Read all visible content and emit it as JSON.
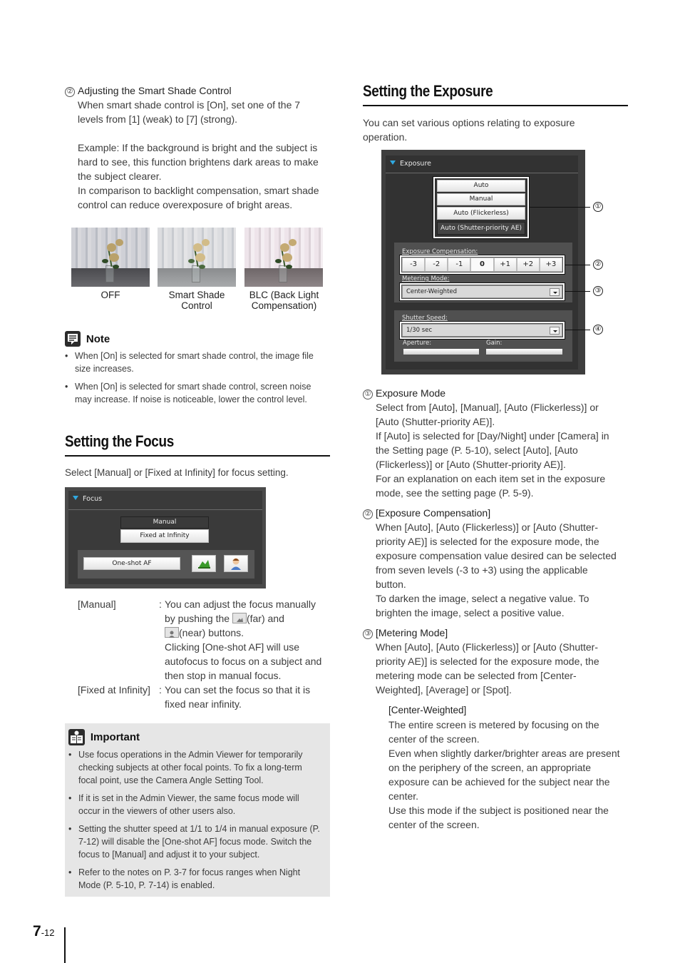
{
  "left_column": {
    "smart_shade": {
      "number": "②",
      "title": "Adjusting the Smart Shade Control",
      "lines": [
        "When smart shade control is [On], set one of the 7",
        "levels from [1] (weak) to [7] (strong).",
        "",
        "Example: If the background is bright and the subject is",
        "hard to see, this function brightens dark areas to make",
        "the subject clearer.",
        "In comparison to backlight compensation, smart shade",
        "control can reduce overexposure of bright areas."
      ]
    },
    "photos": [
      {
        "caption_line1": "OFF",
        "caption_line2": ""
      },
      {
        "caption_line1": "Smart Shade",
        "caption_line2": "Control"
      },
      {
        "caption_line1": "BLC (Back Light",
        "caption_line2": "Compensation)"
      }
    ],
    "note": {
      "title": "Note",
      "icon": "note-icon",
      "items": [
        "When [On] is selected for smart shade control, the image file size increases.",
        "When [On] is selected for smart shade control, screen noise may increase.  If noise is noticeable, lower the control level."
      ]
    },
    "focus": {
      "heading": "Setting the Focus",
      "intro": "Select [Manual] or [Fixed at Infinity] for focus setting.",
      "ui": {
        "panel_title": "Focus",
        "mode_options": [
          "Manual",
          "Fixed at Infinity"
        ],
        "selected_mode": "Manual",
        "one_shot_af_label": "One-shot AF",
        "far_button_icon": "landscape-far-icon",
        "near_button_icon": "person-near-icon"
      },
      "definitions": [
        {
          "term": "[Manual]",
          "lines": [
            "You can adjust the focus manually",
            "by pushing the",
            "(far) and",
            "(near) buttons.",
            "Clicking [One-shot AF] will use",
            "autofocus to focus on a subject and",
            "then stop in manual focus."
          ]
        },
        {
          "term": "[Fixed at Infinity]",
          "lines": [
            "You can set the focus so that it is",
            "fixed near infinity."
          ]
        }
      ]
    },
    "important": {
      "title": "Important",
      "icon": "important-icon",
      "items": [
        "Use focus operations in the Admin Viewer for temporarily checking subjects at other focal points. To fix a long-term focal point, use the Camera Angle Setting Tool.",
        "If it is set in the Admin Viewer, the same focus mode will occur in the viewers of other users also.",
        "Setting the shutter speed at 1/1 to 1/4 in manual exposure (P. 7-12) will disable the [One-shot AF] focus mode. Switch the focus to [Manual] and adjust it to your subject.",
        "Refer to the notes on P. 3-7 for focus ranges when Night Mode (P. 5-10, P. 7-14) is enabled."
      ]
    }
  },
  "right_column": {
    "heading": "Setting the Exposure",
    "intro_lines": [
      "You can set various options relating to exposure",
      "operation."
    ],
    "ui": {
      "panel_title": "Exposure",
      "modes": [
        "Auto",
        "Manual",
        "Auto (Flickerless)",
        "Auto (Shutter-priority AE)"
      ],
      "selected_mode": "Auto (Shutter-priority AE)",
      "exposure_compensation_label": "Exposure Compensation:",
      "compensation_values": [
        "-3",
        "-2",
        "-1",
        "0",
        "+1",
        "+2",
        "+3"
      ],
      "selected_compensation": "0",
      "metering_mode_label": "Metering Mode:",
      "metering_mode_value": "Center-Weighted",
      "shutter_speed_label": "Shutter Speed:",
      "shutter_speed_value": "1/30 sec",
      "aperture_label": "Aperture:",
      "gain_label": "Gain:",
      "callouts": [
        "①",
        "②",
        "③",
        "④"
      ]
    },
    "items": [
      {
        "number": "①",
        "title": "Exposure Mode",
        "lines": [
          "Select from [Auto], [Manual], [Auto (Flickerless)] or",
          "[Auto (Shutter-priority AE)].",
          "If [Auto] is selected for [Day/Night] under [Camera] in",
          "the Setting page (P. 5-10), select [Auto], [Auto",
          "(Flickerless)] or [Auto (Shutter-priority AE)].",
          "For an explanation on each item set in the exposure",
          "mode, see the setting page (P. 5-9)."
        ]
      },
      {
        "number": "②",
        "title": "[Exposure Compensation]",
        "lines": [
          "When [Auto], [Auto (Flickerless)] or [Auto (Shutter-",
          "priority AE)] is selected for the exposure mode, the",
          "exposure compensation value desired can be selected",
          "from seven levels (-3 to +3) using the applicable",
          "button.",
          "To darken the image, select a negative value. To",
          "brighten the image, select a positive value."
        ]
      },
      {
        "number": "③",
        "title": "[Metering Mode]",
        "lines": [
          "When [Auto], [Auto (Flickerless)] or [Auto (Shutter-",
          "priority AE)] is selected for the exposure mode, the",
          "metering mode can be selected from [Center-",
          "Weighted], [Average] or [Spot]."
        ]
      }
    ],
    "center_weighted": {
      "title": "[Center-Weighted]",
      "lines": [
        "The entire screen is metered by focusing on the",
        "center of the screen.",
        "Even when slightly darker/brighter areas are present",
        "on the periphery of the screen, an appropriate",
        "exposure can be achieved for the subject near the",
        "center.",
        "Use this mode if the subject is positioned near the",
        "center of the screen."
      ]
    }
  },
  "footer": {
    "chapter": "7",
    "page": "-12"
  }
}
